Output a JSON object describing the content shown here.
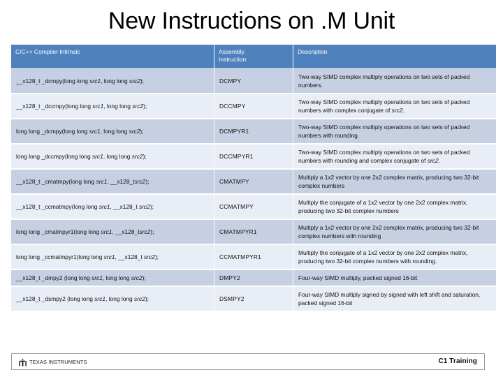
{
  "slide": {
    "title": "New Instructions on .M Unit"
  },
  "table": {
    "headers": {
      "intrinsic": "C/C++ Compiler Intrinsic",
      "assembly_line1": "Assembly",
      "assembly_line2": "Instruction",
      "description": "Description"
    },
    "colors": {
      "header_bg": "#4f81bd",
      "header_text": "#ffffff",
      "row_band_a": "#c7cfe3",
      "row_band_b": "#e9edf5"
    },
    "rows": [
      {
        "intrinsic_pre": "__x128_t _dcmpy(long long ",
        "intrinsic_arg1": "src1",
        "intrinsic_mid": ", long long ",
        "intrinsic_arg2": "src2",
        "intrinsic_post": ");",
        "assembly": "DCMPY",
        "desc_pre": "Two-way SIMD complex multiply operations on two sets of packed numbers.",
        "desc_arg": "",
        "desc_post": ""
      },
      {
        "intrinsic_pre": "__x128_t _dccmpy(long long ",
        "intrinsic_arg1": "src1",
        "intrinsic_mid": ", long long ",
        "intrinsic_arg2": "src2",
        "intrinsic_post": ");",
        "assembly": "DCCMPY",
        "desc_pre": "Two-way SIMD complex multiply operations on two sets of packed numbers with complex conjugate of ",
        "desc_arg": "src2",
        "desc_post": "."
      },
      {
        "intrinsic_pre": "long long _dcmpy(long long ",
        "intrinsic_arg1": "src1",
        "intrinsic_mid": ", long long ",
        "intrinsic_arg2": "src2",
        "intrinsic_post": ");",
        "assembly": "DCMPYR1",
        "desc_pre": "Two-way SIMD complex multiply operations on two sets of packed numbers with rounding.",
        "desc_arg": "",
        "desc_post": ""
      },
      {
        "intrinsic_pre": "long long  _dccmpy(long long ",
        "intrinsic_arg1": "src1",
        "intrinsic_mid": ", long long ",
        "intrinsic_arg2": "src2",
        "intrinsic_post": ");",
        "assembly": "DCCMPYR1",
        "desc_pre": "Two-way SIMD complex multiply operations on two sets of packed numbers with rounding and complex conjugate of ",
        "desc_arg": "src2",
        "desc_post": "."
      },
      {
        "intrinsic_pre": "__x128_t _cmatmpy(long long ",
        "intrinsic_arg1": "src1",
        "intrinsic_mid": ", __x128_t",
        "intrinsic_arg2": "src2",
        "intrinsic_post": ");",
        "assembly": "CMATMPY",
        "desc_pre": "Multiply a 1x2 vector by one 2x2 complex matrix, producing two 32-bit complex numbers",
        "desc_arg": "",
        "desc_post": ""
      },
      {
        "intrinsic_pre": "__x128_t _ccmatmpy(long long ",
        "intrinsic_arg1": "src1",
        "intrinsic_mid": ", __x128_t ",
        "intrinsic_arg2": "src2",
        "intrinsic_post": ");",
        "assembly": "CCMATMPY",
        "desc_pre": "Multiply the conjugate of a 1x2 vector by one 2x2 complex matrix, producing two 32-bit complex numbers",
        "desc_arg": "",
        "desc_post": ""
      },
      {
        "intrinsic_pre": "long long  _cmatmpyr1(long long ",
        "intrinsic_arg1": "src1",
        "intrinsic_mid": ", __x128_t",
        "intrinsic_arg2": "src2",
        "intrinsic_post": ");",
        "assembly": "CMATMPYR1",
        "desc_pre": "Multiply a 1x2 vector by one 2x2 complex matrix, producing two 32-bit complex numbers with rounding",
        "desc_arg": "",
        "desc_post": ""
      },
      {
        "intrinsic_pre": "long long  _ccmatmpyr1(long long ",
        "intrinsic_arg1": "src1",
        "intrinsic_mid": ", __x128_t ",
        "intrinsic_arg2": "src2",
        "intrinsic_post": ");",
        "assembly": "CCMATMPYR1",
        "desc_pre": "Multiply the conjugate of a 1x2 vector by one 2x2 complex matrix, producing two 32-bit complex numbers with rounding.",
        "desc_arg": "",
        "desc_post": ""
      },
      {
        "intrinsic_pre": "__x128_t _dmpy2 (long long ",
        "intrinsic_arg1": "src1",
        "intrinsic_mid": ", long long ",
        "intrinsic_arg2": "src2",
        "intrinsic_post": ");",
        "assembly": "DMPY2",
        "desc_pre": "Four-way SIMD multiply, packed signed 16-bit",
        "desc_arg": "",
        "desc_post": ""
      },
      {
        "intrinsic_pre": "__x128_t _dsmpy2 (long long ",
        "intrinsic_arg1": "src1",
        "intrinsic_mid": ", long long ",
        "intrinsic_arg2": "src2",
        "intrinsic_post": ");",
        "assembly": "DSMPY2",
        "desc_pre": "Four-way SIMD multiply signed by signed with left shift and saturation, packed signed 16-bit",
        "desc_arg": "",
        "desc_post": ""
      }
    ]
  },
  "footer": {
    "logo_text": "Texas Instruments",
    "training_label": "C1 Training"
  }
}
